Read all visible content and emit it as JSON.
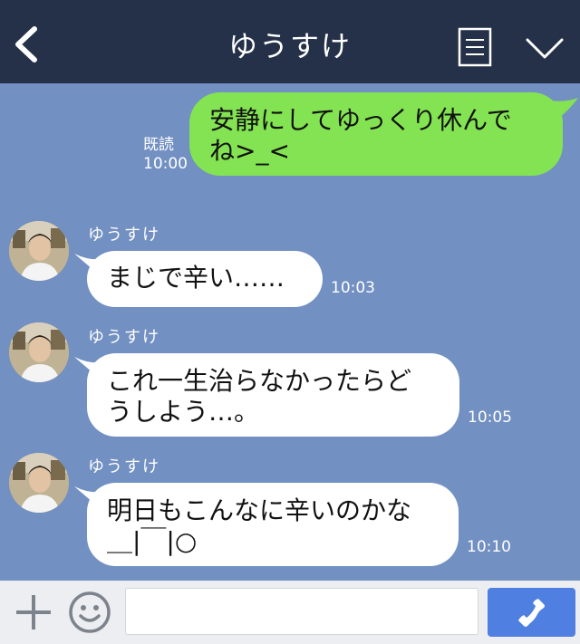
{
  "header": {
    "title": "ゆうすけ",
    "back_icon": "chevron-left-icon",
    "menu_icon": "notes-icon",
    "expand_icon": "chevron-down-icon"
  },
  "messages": [
    {
      "direction": "outgoing",
      "lines": [
        "安静にしてゆっくり休んで",
        "ね>_<"
      ],
      "read_label": "既読",
      "time": "10:00"
    },
    {
      "direction": "incoming",
      "sender": "ゆうすけ",
      "lines": [
        "まじで辛い……"
      ],
      "time": "10:03"
    },
    {
      "direction": "incoming",
      "sender": "ゆうすけ",
      "lines": [
        "これ一生治らなかったらど",
        "うしよう…。"
      ],
      "time": "10:05"
    },
    {
      "direction": "incoming",
      "sender": "ゆうすけ",
      "lines": [
        "明日もこんなに辛いのかな",
        "＿|￣|○"
      ],
      "time": "10:10"
    }
  ],
  "input_bar": {
    "plus_icon": "plus-icon",
    "emoji_icon": "smiley-icon",
    "message_value": "",
    "call_icon": "phone-icon"
  },
  "colors": {
    "header_bg": "#253148",
    "chat_bg": "#7290c1",
    "outgoing_bubble": "#84e352",
    "incoming_bubble": "#ffffff",
    "call_button": "#4f7fe1"
  }
}
